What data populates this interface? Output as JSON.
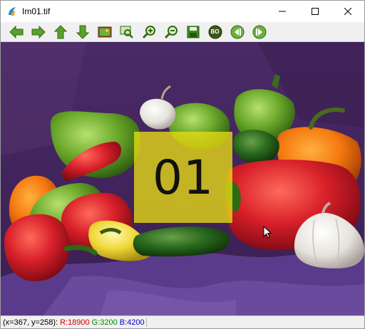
{
  "window": {
    "title": "Im01.tif",
    "controls": {
      "minimize": "minimize-icon",
      "maximize": "maximize-icon",
      "close": "close-icon"
    }
  },
  "toolbar": {
    "buttons": [
      {
        "name": "back-button",
        "icon": "arrow-left-icon"
      },
      {
        "name": "forward-button",
        "icon": "arrow-right-icon"
      },
      {
        "name": "up-button",
        "icon": "arrow-up-icon"
      },
      {
        "name": "down-button",
        "icon": "arrow-down-icon"
      },
      {
        "name": "image-button",
        "icon": "picture-icon"
      },
      {
        "name": "zoom-fit-button",
        "icon": "zoom-region-icon"
      },
      {
        "name": "zoom-in-button",
        "icon": "zoom-in-icon"
      },
      {
        "name": "zoom-out-button",
        "icon": "zoom-out-icon"
      },
      {
        "name": "save-button",
        "icon": "floppy-disk-icon"
      },
      {
        "name": "bo-button",
        "icon": "bo-icon",
        "label": "BO"
      },
      {
        "name": "previous-button",
        "icon": "previous-icon"
      },
      {
        "name": "next-button",
        "icon": "next-icon"
      }
    ],
    "accent_green": "#5aa02c",
    "accent_dark": "#2e6b12"
  },
  "image": {
    "overlay_label": "01",
    "overlay_color": "#e8dc14"
  },
  "status": {
    "coords": "(x=367, y=258):",
    "r": "R:18900",
    "g": "G:3200",
    "b": "B:4200"
  }
}
